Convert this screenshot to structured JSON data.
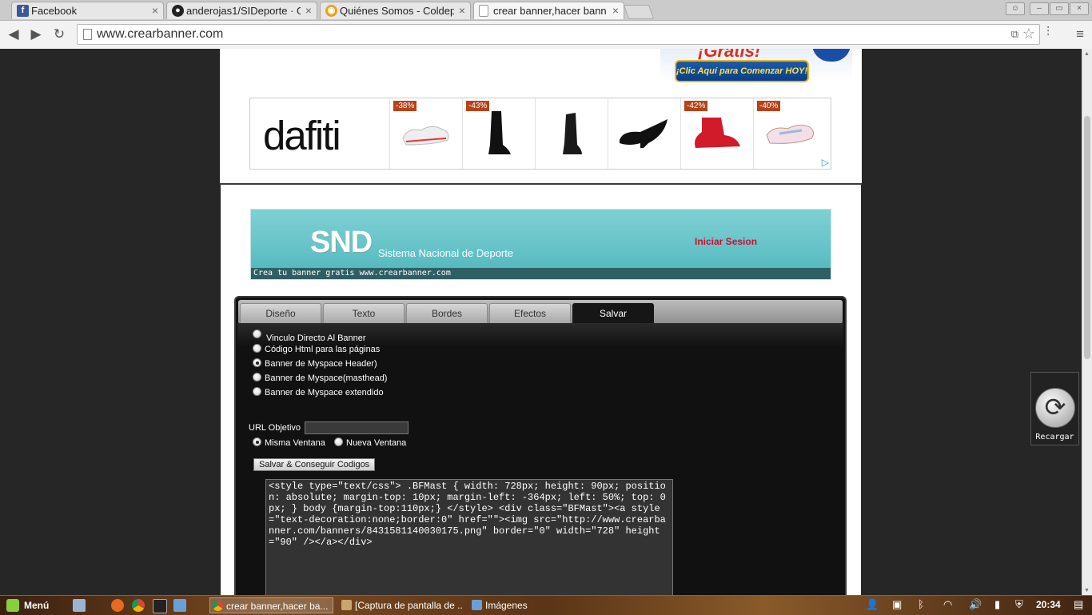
{
  "browser": {
    "tabs": [
      {
        "title": "Facebook",
        "icon": "facebook-icon"
      },
      {
        "title": "anderojas1/SIDeporte · G",
        "icon": "github-icon"
      },
      {
        "title": "Quiénes Somos - Coldep",
        "icon": "coldeportes-icon"
      },
      {
        "title": "crear banner,hacer bann",
        "icon": "page-icon"
      }
    ],
    "url": "www.crearbanner.com"
  },
  "promo": {
    "gratis": "¡Gratis!",
    "button": "¡Clic Aquí para Comenzar HOY!"
  },
  "ad": {
    "brand": "dafiti",
    "items": [
      {
        "discount": "-38%"
      },
      {
        "discount": "-43%"
      },
      {
        "discount": ""
      },
      {
        "discount": ""
      },
      {
        "discount": "-42%"
      },
      {
        "discount": "-40%"
      }
    ]
  },
  "banner": {
    "title": "SND",
    "subtitle": "Sistema Nacional de Deporte",
    "login": "Iniciar Sesion",
    "footer": "Crea tu banner gratis www.crearbanner.com"
  },
  "editor": {
    "tabs": [
      "Diseño",
      "Texto",
      "Bordes",
      "Efectos",
      "Salvar"
    ],
    "selected_tab": "Salvar",
    "options": [
      {
        "label": "Vinculo Directo Al Banner",
        "checked": false
      },
      {
        "label": "Código Html para las páginas",
        "checked": false
      },
      {
        "label": "Banner de Myspace Header)",
        "checked": true
      },
      {
        "label": "Banner de Myspace(masthead)",
        "checked": false
      },
      {
        "label": "Banner de Myspace extendido",
        "checked": false
      }
    ],
    "url_label": "URL Objetivo",
    "url_value": "",
    "window_options": [
      {
        "label": "Misma Ventana",
        "checked": true
      },
      {
        "label": "Nueva Ventana",
        "checked": false
      }
    ],
    "save_button": "Salvar & Conseguir Codigos",
    "code": "<style type=\"text/css\"> .BFMast { width: 728px; height: 90px; position: absolute; margin-top: 10px; margin-left: -364px; left: 50%; top: 0px; } body {margin-top:110px;} </style> <div class=\"BFMast\"><a style=\"text-decoration:none;border:0\" href=\"\"><img src=\"http://www.crearbanner.com/banners/8431581140030175.png\" border=\"0\" width=\"728\" height=\"90\" /></a></div>"
  },
  "reload_widget": {
    "label": "Recargar"
  },
  "taskbar": {
    "menu": "Menú",
    "tasks": [
      {
        "title": "crear banner,hacer ba...",
        "active": true
      },
      {
        "title": "[Captura de pantalla de ...",
        "active": false
      },
      {
        "title": "Imágenes",
        "active": false
      }
    ],
    "clock": "20:34"
  },
  "colors": {
    "accent_red": "#c8102e",
    "banner_teal": "#63c2c7",
    "discount_badge": "#b74218"
  }
}
